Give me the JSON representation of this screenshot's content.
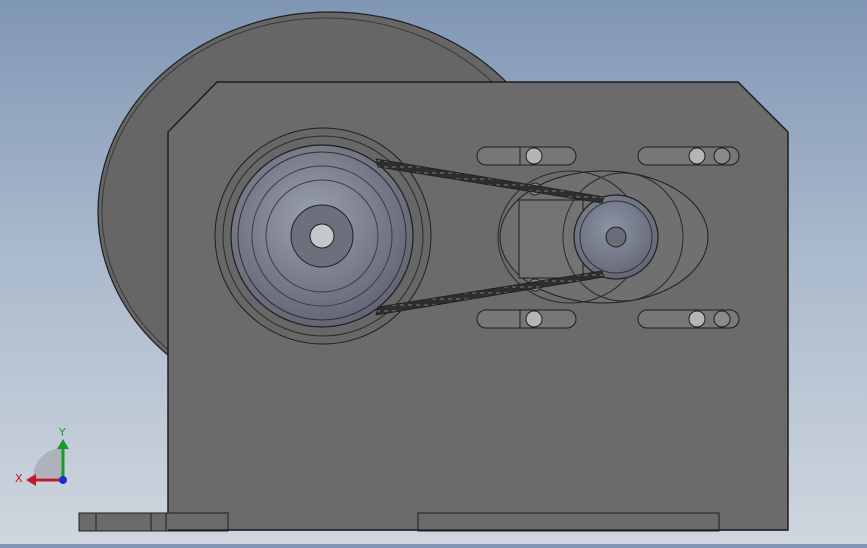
{
  "view": {
    "background_top": "#7f96b4",
    "background_bottom": "#cfd6de"
  },
  "part_colors": {
    "housing": "#6b6b6b",
    "housing_edge": "#1e1e1e",
    "back_disc": "#656565",
    "pulley_face": "#727480",
    "pulley_highlight": "#9aa0b0",
    "belt": "#2e2e2e",
    "slot": "#7a7a7a"
  },
  "triad": {
    "x_label": "X",
    "y_label": "Y",
    "x_color": "#c0192b",
    "y_color": "#1a9a2a",
    "z_color": "#1a2fd0",
    "x_icon": "x-axis-arrow-icon",
    "y_icon": "y-axis-arrow-icon",
    "z_icon": "z-axis-dot-icon"
  }
}
